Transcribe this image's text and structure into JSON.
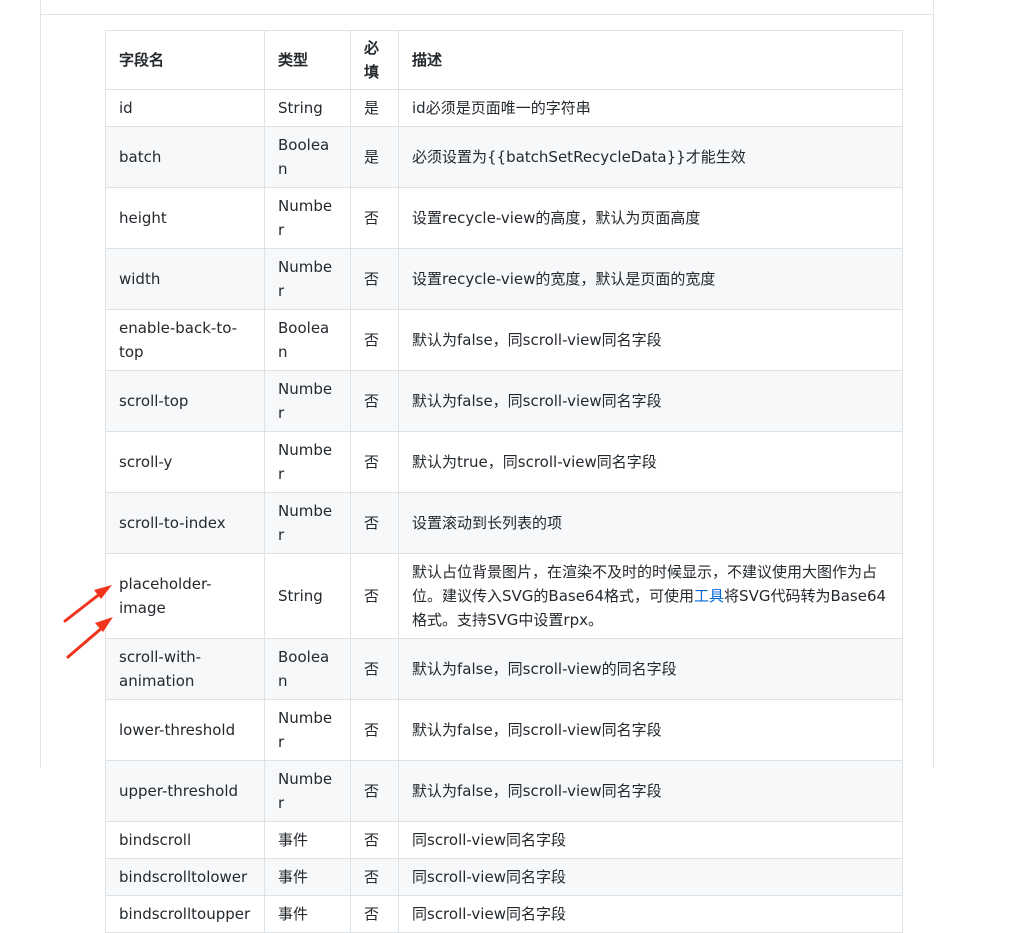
{
  "table": {
    "headers": {
      "name": "字段名",
      "type": "类型",
      "required": "必填",
      "desc": "描述"
    },
    "rows": [
      {
        "name": "id",
        "type": "String",
        "required": "是",
        "desc": "id必须是页面唯一的字符串"
      },
      {
        "name": "batch",
        "type": "Boolean",
        "required": "是",
        "desc": "必须设置为{{batchSetRecycleData}}才能生效"
      },
      {
        "name": "height",
        "type": "Number",
        "required": "否",
        "desc": "设置recycle-view的高度，默认为页面高度"
      },
      {
        "name": "width",
        "type": "Number",
        "required": "否",
        "desc": "设置recycle-view的宽度，默认是页面的宽度"
      },
      {
        "name": "enable-back-to-top",
        "type": "Boolean",
        "required": "否",
        "desc": "默认为false，同scroll-view同名字段"
      },
      {
        "name": "scroll-top",
        "type": "Number",
        "required": "否",
        "desc": "默认为false，同scroll-view同名字段"
      },
      {
        "name": "scroll-y",
        "type": "Number",
        "required": "否",
        "desc": "默认为true，同scroll-view同名字段"
      },
      {
        "name": "scroll-to-index",
        "type": "Number",
        "required": "否",
        "desc": "设置滚动到长列表的项"
      },
      {
        "name": "placeholder-image",
        "type": "String",
        "required": "否",
        "desc": ""
      },
      {
        "name": "scroll-with-animation",
        "type": "Boolean",
        "required": "否",
        "desc": "默认为false，同scroll-view的同名字段"
      },
      {
        "name": "lower-threshold",
        "type": "Number",
        "required": "否",
        "desc": "默认为false，同scroll-view同名字段"
      },
      {
        "name": "upper-threshold",
        "type": "Number",
        "required": "否",
        "desc": "默认为false，同scroll-view同名字段"
      },
      {
        "name": "bindscroll",
        "type": "事件",
        "required": "否",
        "desc": "同scroll-view同名字段"
      },
      {
        "name": "bindscrolltolower",
        "type": "事件",
        "required": "否",
        "desc": "同scroll-view同名字段"
      },
      {
        "name": "bindscrolltoupper",
        "type": "事件",
        "required": "否",
        "desc": "同scroll-view同名字段"
      }
    ],
    "placeholder_desc": {
      "before": "默认占位背景图片，在渲染不及时的时候显示，不建议使用大图作为占位。建议传入SVG的Base64格式，可使用",
      "link": "工具",
      "after": "将SVG代码转为Base64格式。支持SVG中设置rpx。"
    }
  },
  "colors": {
    "arrow": "#f0341c",
    "link": "#0366d6",
    "border": "#dfe2e5",
    "alt_row": "#f6f8fa"
  }
}
